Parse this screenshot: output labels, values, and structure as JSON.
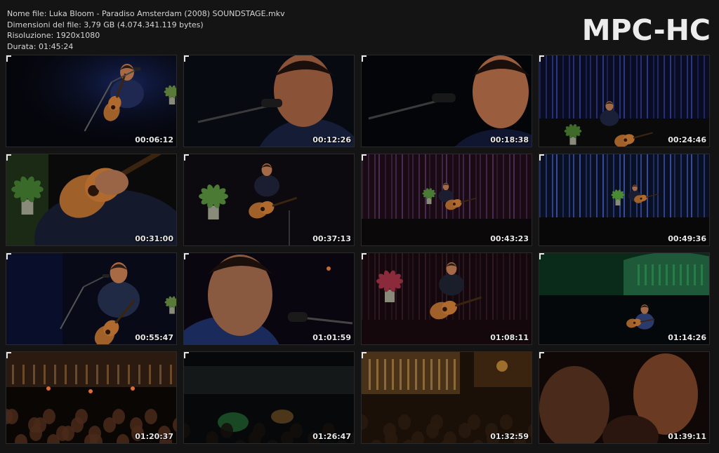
{
  "info": {
    "filename": "Nome file: Luka Bloom - Paradiso Amsterdam (2008) SOUNDSTAGE.mkv",
    "filesize": "Dimensioni del file: 3,79 GB (4.074.341.119 bytes)",
    "resolution": "Risoluzione: 1920x1080",
    "duration": "Durata: 01:45:24"
  },
  "brand": "MPC-HC",
  "thumbnails": [
    {
      "time": "00:06:12",
      "scene": "singer-mic-wide"
    },
    {
      "time": "00:12:26",
      "scene": "singer-closeup-mic"
    },
    {
      "time": "00:18:38",
      "scene": "singer-face-closeup"
    },
    {
      "time": "00:24:46",
      "scene": "stage-blue-wide"
    },
    {
      "time": "00:31:00",
      "scene": "guitar-closeup"
    },
    {
      "time": "00:37:13",
      "scene": "singer-guitar-flowers"
    },
    {
      "time": "00:43:23",
      "scene": "stage-red-wide"
    },
    {
      "time": "00:49:36",
      "scene": "stage-blue-far"
    },
    {
      "time": "00:55:47",
      "scene": "singer-mic-blue"
    },
    {
      "time": "01:01:59",
      "scene": "singer-profile"
    },
    {
      "time": "01:08:11",
      "scene": "singer-guitar-red"
    },
    {
      "time": "01:14:26",
      "scene": "stage-green-balcony"
    },
    {
      "time": "01:20:37",
      "scene": "audience-hall"
    },
    {
      "time": "01:26:47",
      "scene": "hall-dark-green"
    },
    {
      "time": "01:32:59",
      "scene": "hall-balcony-warm"
    },
    {
      "time": "01:39:11",
      "scene": "audience-closeup"
    }
  ],
  "colors": {
    "background": "#141414",
    "text": "#d6d6d6",
    "brand": "#ececec"
  }
}
